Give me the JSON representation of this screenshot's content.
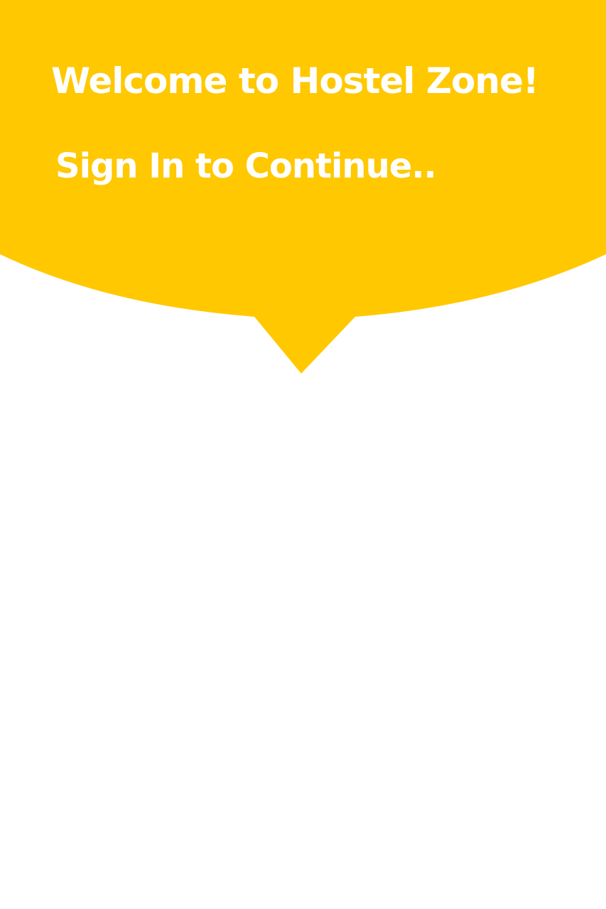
{
  "theme": {
    "accent_color": "#FFC800",
    "text_color": "#FFFFFF",
    "background_color": "#FFFFFF"
  },
  "header": {
    "title": "Welcome to Hostel Zone!",
    "subtitle": "Sign In to Continue.."
  }
}
